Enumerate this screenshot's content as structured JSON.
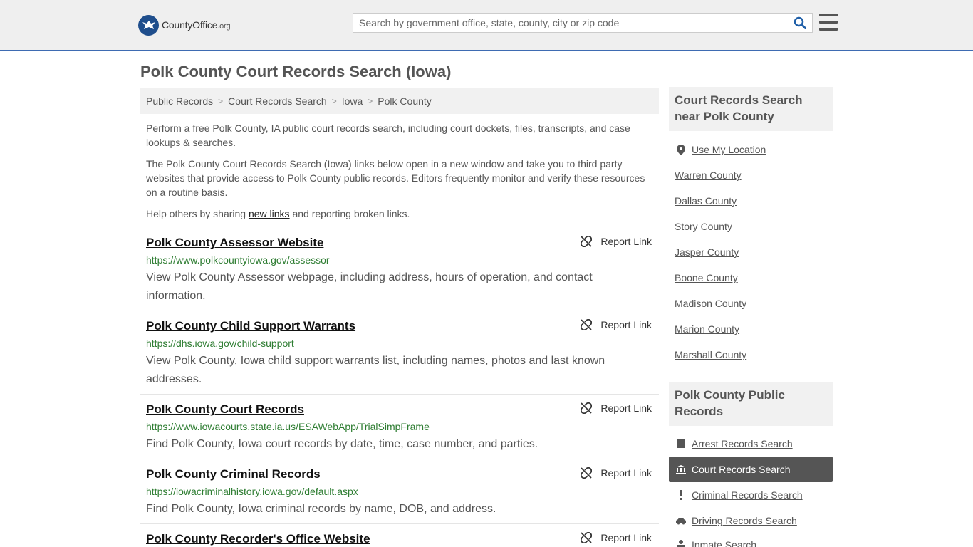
{
  "header": {
    "logo_brand": "CountyOffice",
    "logo_tld": ".org",
    "search_placeholder": "Search by government office, state, county, city or zip code"
  },
  "page_title": "Polk County Court Records Search (Iowa)",
  "breadcrumb": [
    "Public Records",
    "Court Records Search",
    "Iowa",
    "Polk County"
  ],
  "intro": {
    "p1": "Perform a free Polk County, IA public court records search, including court dockets, files, transcripts, and case lookups & searches.",
    "p2": "The Polk County Court Records Search (Iowa) links below open in a new window and take you to third party websites that provide access to Polk County public records. Editors frequently monitor and verify these resources on a routine basis.",
    "p3_before": "Help others by sharing ",
    "p3_link": "new links",
    "p3_after": " and reporting broken links."
  },
  "report_label": "Report Link",
  "entries": [
    {
      "title": "Polk County Assessor Website",
      "url": "https://www.polkcountyiowa.gov/assessor",
      "desc": "View Polk County Assessor webpage, including address, hours of operation, and contact information."
    },
    {
      "title": "Polk County Child Support Warrants",
      "url": "https://dhs.iowa.gov/child-support",
      "desc": "View Polk County, Iowa child support warrants list, including names, photos and last known addresses."
    },
    {
      "title": "Polk County Court Records",
      "url": "https://www.iowacourts.state.ia.us/ESAWebApp/TrialSimpFrame",
      "desc": "Find Polk County, Iowa court records by date, time, case number, and parties."
    },
    {
      "title": "Polk County Criminal Records",
      "url": "https://iowacriminalhistory.iowa.gov/default.aspx",
      "desc": "Find Polk County, Iowa criminal records by name, DOB, and address."
    },
    {
      "title": "Polk County Recorder's Office Website",
      "url": "",
      "desc": ""
    }
  ],
  "sidebar": {
    "nearby_title": "Court Records Search near Polk County",
    "use_location": "Use My Location",
    "nearby": [
      "Warren County",
      "Dallas County",
      "Story County",
      "Jasper County",
      "Boone County",
      "Madison County",
      "Marion County",
      "Marshall County"
    ],
    "public_title": "Polk County Public Records",
    "public_links": [
      {
        "label": "Arrest Records Search",
        "icon": "square-icon"
      },
      {
        "label": "Court Records Search",
        "icon": "courthouse-icon"
      },
      {
        "label": "Criminal Records Search",
        "icon": "exclamation-icon"
      },
      {
        "label": "Driving Records Search",
        "icon": "car-icon"
      },
      {
        "label": "Inmate Search",
        "icon": "inmate-icon"
      }
    ]
  },
  "colors": {
    "accent": "#3e6bb2",
    "url_green": "#2e7d32",
    "active_bg": "#555555"
  }
}
